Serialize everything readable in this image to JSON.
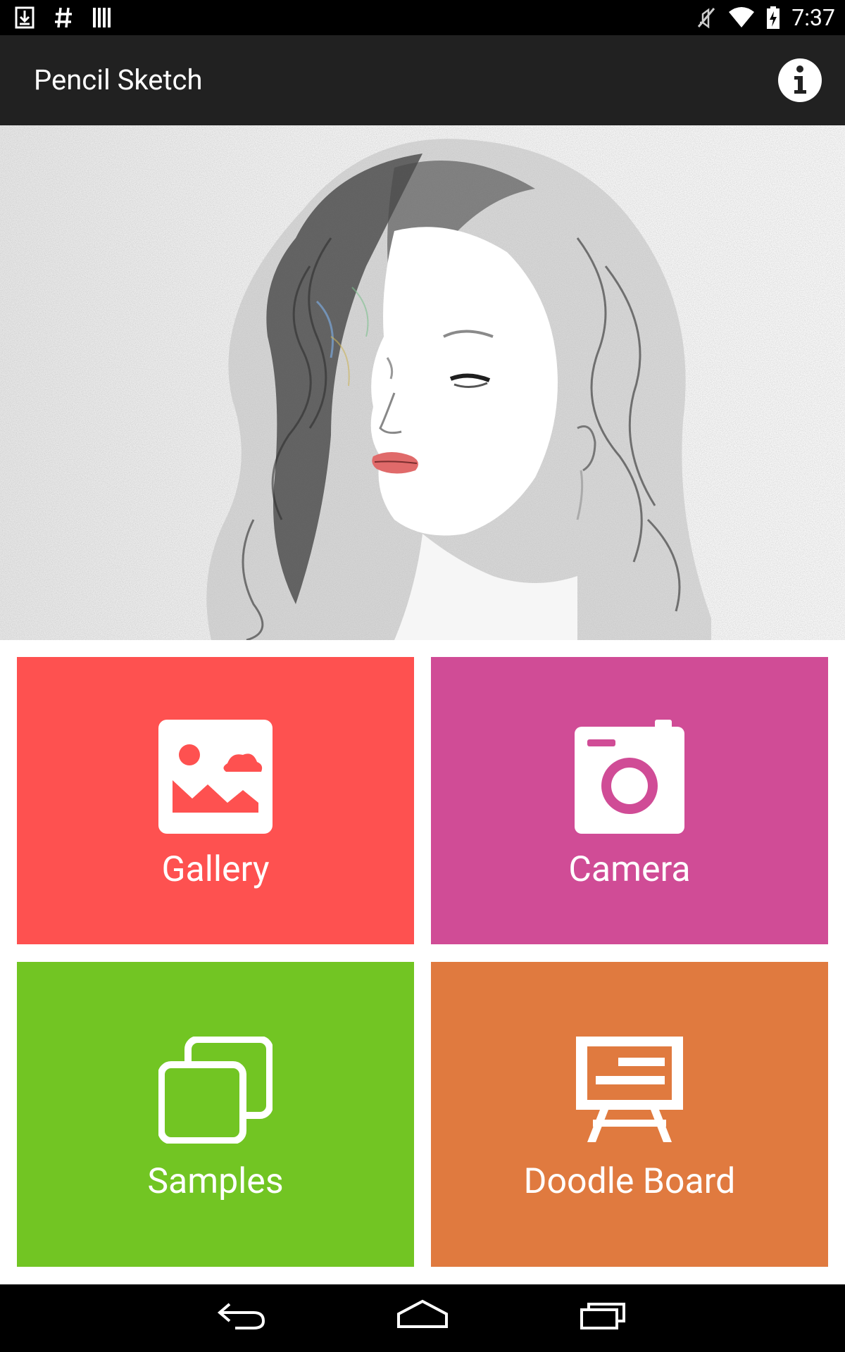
{
  "status_bar": {
    "left_icons": [
      "download-icon",
      "hash-icon",
      "barcode-icon"
    ],
    "right_icons": [
      "mute-icon",
      "wifi-icon",
      "battery-charging-icon"
    ],
    "time": "7:37"
  },
  "app_bar": {
    "title": "Pencil Sketch",
    "action_icon": "info-icon",
    "background": "#212121"
  },
  "hero": {
    "image": "pencil-sketch-portrait"
  },
  "tiles": [
    {
      "label": "Gallery",
      "icon": "image-icon",
      "color": "#fe5150"
    },
    {
      "label": "Camera",
      "icon": "camera-icon",
      "color": "#d04c96"
    },
    {
      "label": "Samples",
      "icon": "stacked-cards-icon",
      "color": "#72c523"
    },
    {
      "label": "Doodle Board",
      "icon": "easel-icon",
      "color": "#e07a3f"
    }
  ],
  "nav_bar": {
    "buttons": [
      "back-icon",
      "home-icon",
      "recents-icon"
    ]
  }
}
